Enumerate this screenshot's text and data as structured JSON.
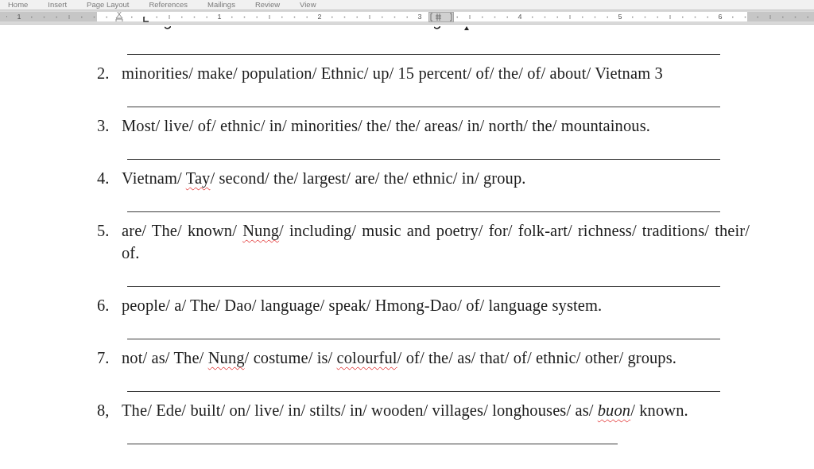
{
  "ribbon_tabs": [
    {
      "label": "Home",
      "selected": false
    },
    {
      "label": "Insert",
      "selected": false
    },
    {
      "label": "Page Layout",
      "selected": false
    },
    {
      "label": "References",
      "selected": false
    },
    {
      "label": "Mailings",
      "selected": false
    },
    {
      "label": "Review",
      "selected": false
    },
    {
      "label": "View",
      "selected": false
    }
  ],
  "ruler": {
    "left_numbers": [
      "1"
    ],
    "numbers": [
      "1",
      "2",
      "3",
      "4",
      "5",
      "6"
    ]
  },
  "items": [
    {
      "number": "2.",
      "segments": [
        {
          "text": "minorities/ make/ population/ Ethnic/ up/ 15 percent/ of/ the/ of/ about/ Vietnam 3",
          "flagged": false
        }
      ]
    },
    {
      "number": "3.",
      "segments": [
        {
          "text": "Most/ live/ of/ ethnic/ in/ minorities/ the/ the/ areas/ in/ north/ the/ mountainous.",
          "flagged": false
        }
      ]
    },
    {
      "number": "4.",
      "segments": [
        {
          "text": "Vietnam/ ",
          "flagged": false
        },
        {
          "text": "Tay",
          "flagged": true
        },
        {
          "text": "/ second/ the/ largest/ are/ the/ ethnic/ in/ group.",
          "flagged": false
        }
      ]
    },
    {
      "number": "5.",
      "segments": [
        {
          "text": "are/ The/ known/ ",
          "flagged": false
        },
        {
          "text": "Nung",
          "flagged": true
        },
        {
          "text": "/ including/ music and poetry/ for/ folk-art/ richness/ traditions/ their/ of.",
          "flagged": false
        }
      ]
    },
    {
      "number": "6.",
      "segments": [
        {
          "text": "people/ a/ The/ Dao/ language/ speak/ Hmong-Dao/ of/ language system.",
          "flagged": false
        }
      ]
    },
    {
      "number": "7.",
      "segments": [
        {
          "text": "not/ as/ The/ ",
          "flagged": false
        },
        {
          "text": "Nung",
          "flagged": true
        },
        {
          "text": "/ costume/ is/ ",
          "flagged": false
        },
        {
          "text": "colourful",
          "flagged": true
        },
        {
          "text": "/ of/ the/ as/ that/ of/ ethnic/ other/ groups.",
          "flagged": false
        }
      ]
    },
    {
      "number": "8,",
      "segments": [
        {
          "text": "The/ Ede/ built/ on/ live/ in/ stilts/ in/ wooden/ villages/ longhouses/ as/ ",
          "flagged": false
        },
        {
          "text": "*buon*",
          "flagged": true
        },
        {
          "text": "/ known.",
          "flagged": false
        }
      ]
    }
  ]
}
